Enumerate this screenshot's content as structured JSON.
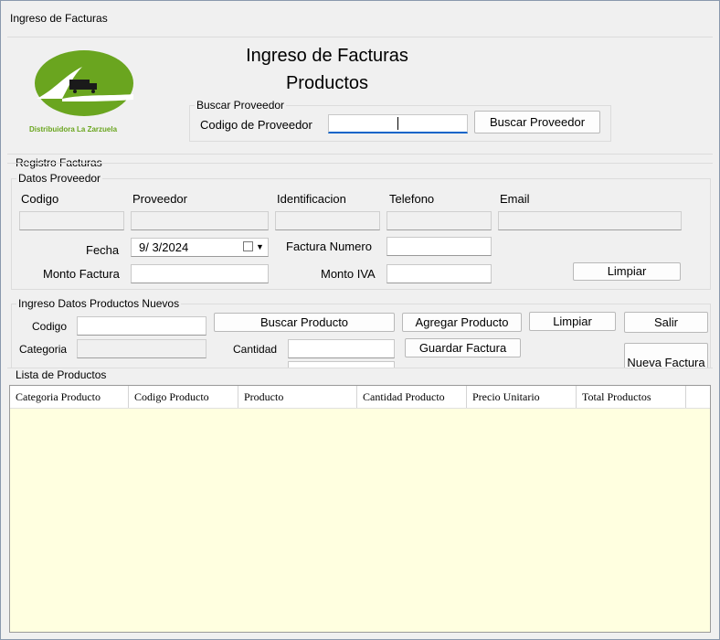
{
  "window": {
    "title": "Ingreso de Facturas"
  },
  "header": {
    "title_line1": "Ingreso de Facturas",
    "title_line2": "Productos"
  },
  "logo": {
    "caption": "Distribuidora La Zarzuela",
    "color": "#6aa51f"
  },
  "buscar_proveedor": {
    "group_label": "Buscar Proveedor",
    "codigo_label": "Codigo de Proveedor",
    "codigo_value": "",
    "button_label": "Buscar Proveedor"
  },
  "registro": {
    "section_label": "Registro Facturas",
    "datos_label": "Datos Proveedor",
    "columns": {
      "codigo": "Codigo",
      "proveedor": "Proveedor",
      "identificacion": "Identificacion",
      "telefono": "Telefono",
      "email": "Email"
    },
    "fecha_label": "Fecha",
    "fecha_value": "9/  3/2024",
    "factura_numero_label": "Factura Numero",
    "monto_factura_label": "Monto Factura",
    "monto_iva_label": "Monto IVA",
    "limpiar_label": "Limpiar"
  },
  "productos": {
    "group_label": "Ingreso Datos Productos Nuevos",
    "codigo_label": "Codigo",
    "categoria_label": "Categoria",
    "cantidad_label": "Cantidad",
    "buscar_producto_label": "Buscar Producto",
    "agregar_producto_label": "Agregar Producto",
    "limpiar_label": "Limpiar",
    "salir_label": "Salir",
    "guardar_factura_label": "Guardar Factura",
    "nueva_factura_label": "Nueva Factura"
  },
  "lista": {
    "label": "Lista de Productos",
    "columns": [
      "Categoria Producto",
      "Codigo Producto",
      "Producto",
      "Cantidad Producto",
      "Precio Unitario",
      "Total Productos"
    ]
  }
}
